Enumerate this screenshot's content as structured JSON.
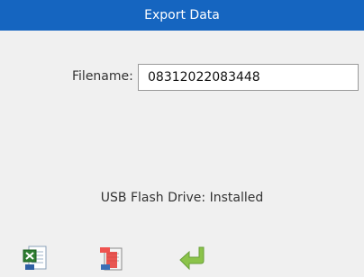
{
  "window": {
    "title": "Export Data"
  },
  "filename": {
    "label": "Filename:",
    "value": "08312022083448"
  },
  "usb": {
    "status": "USB Flash Drive: Installed"
  },
  "toolbar": {
    "buttons": [
      {
        "name": "export-excel-button",
        "icon": "excel-export-icon",
        "color": "#2e7d32"
      },
      {
        "name": "export-pdf-button",
        "icon": "pdf-export-icon",
        "color": "#e53935"
      },
      {
        "name": "back-button",
        "icon": "return-arrow-icon",
        "color": "#8bc34a"
      }
    ]
  },
  "colors": {
    "titlebar": "#1565c0",
    "background": "#f0f0f0",
    "input_border": "#9a9a9a"
  }
}
